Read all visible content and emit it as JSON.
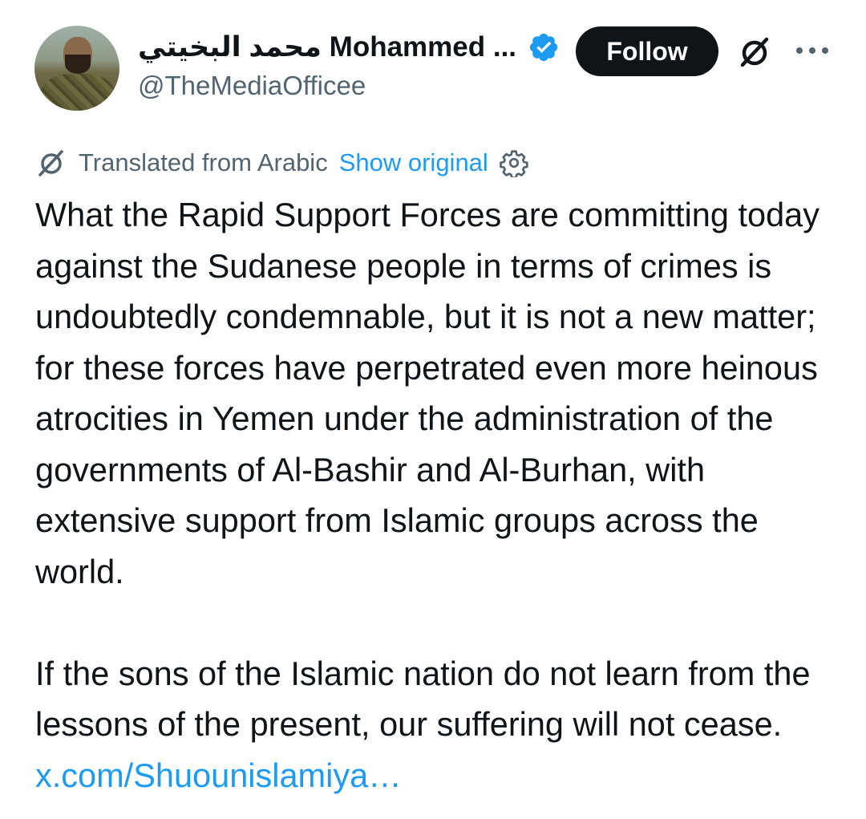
{
  "author": {
    "display_name": "محمد البخيتي Mohammed ...",
    "handle": "@TheMediaOfficee",
    "verified": true,
    "avatar": "avatar-photo"
  },
  "actions": {
    "follow_label": "Follow",
    "grok_icon": "grok-slash-circle-icon",
    "more_icon": "more-dots-icon"
  },
  "translation": {
    "label": "Translated from Arabic",
    "show_original": "Show original",
    "icon": "grok-slash-circle-icon",
    "settings_icon": "gear-icon"
  },
  "tweet": {
    "paragraph1": "What the Rapid Support Forces are committing today against the Sudanese people in terms of crimes is undoubtedly condemnable, but it is not a new matter; for these forces have perpetrated even more heinous atrocities in Yemen under the administration of the governments of Al-Bashir and Al-Burhan, with extensive support from Islamic groups across the world.",
    "paragraph2": "If the sons of the Islamic nation do not learn from the lessons of the present, our suffering will not cease.",
    "link": "x.com/Shuounislamiya…"
  },
  "colors": {
    "text": "#0f1419",
    "secondary": "#536471",
    "link": "#1d9bf0",
    "verified": "#1d9bf0",
    "button_bg": "#0f1419",
    "button_text": "#ffffff"
  }
}
